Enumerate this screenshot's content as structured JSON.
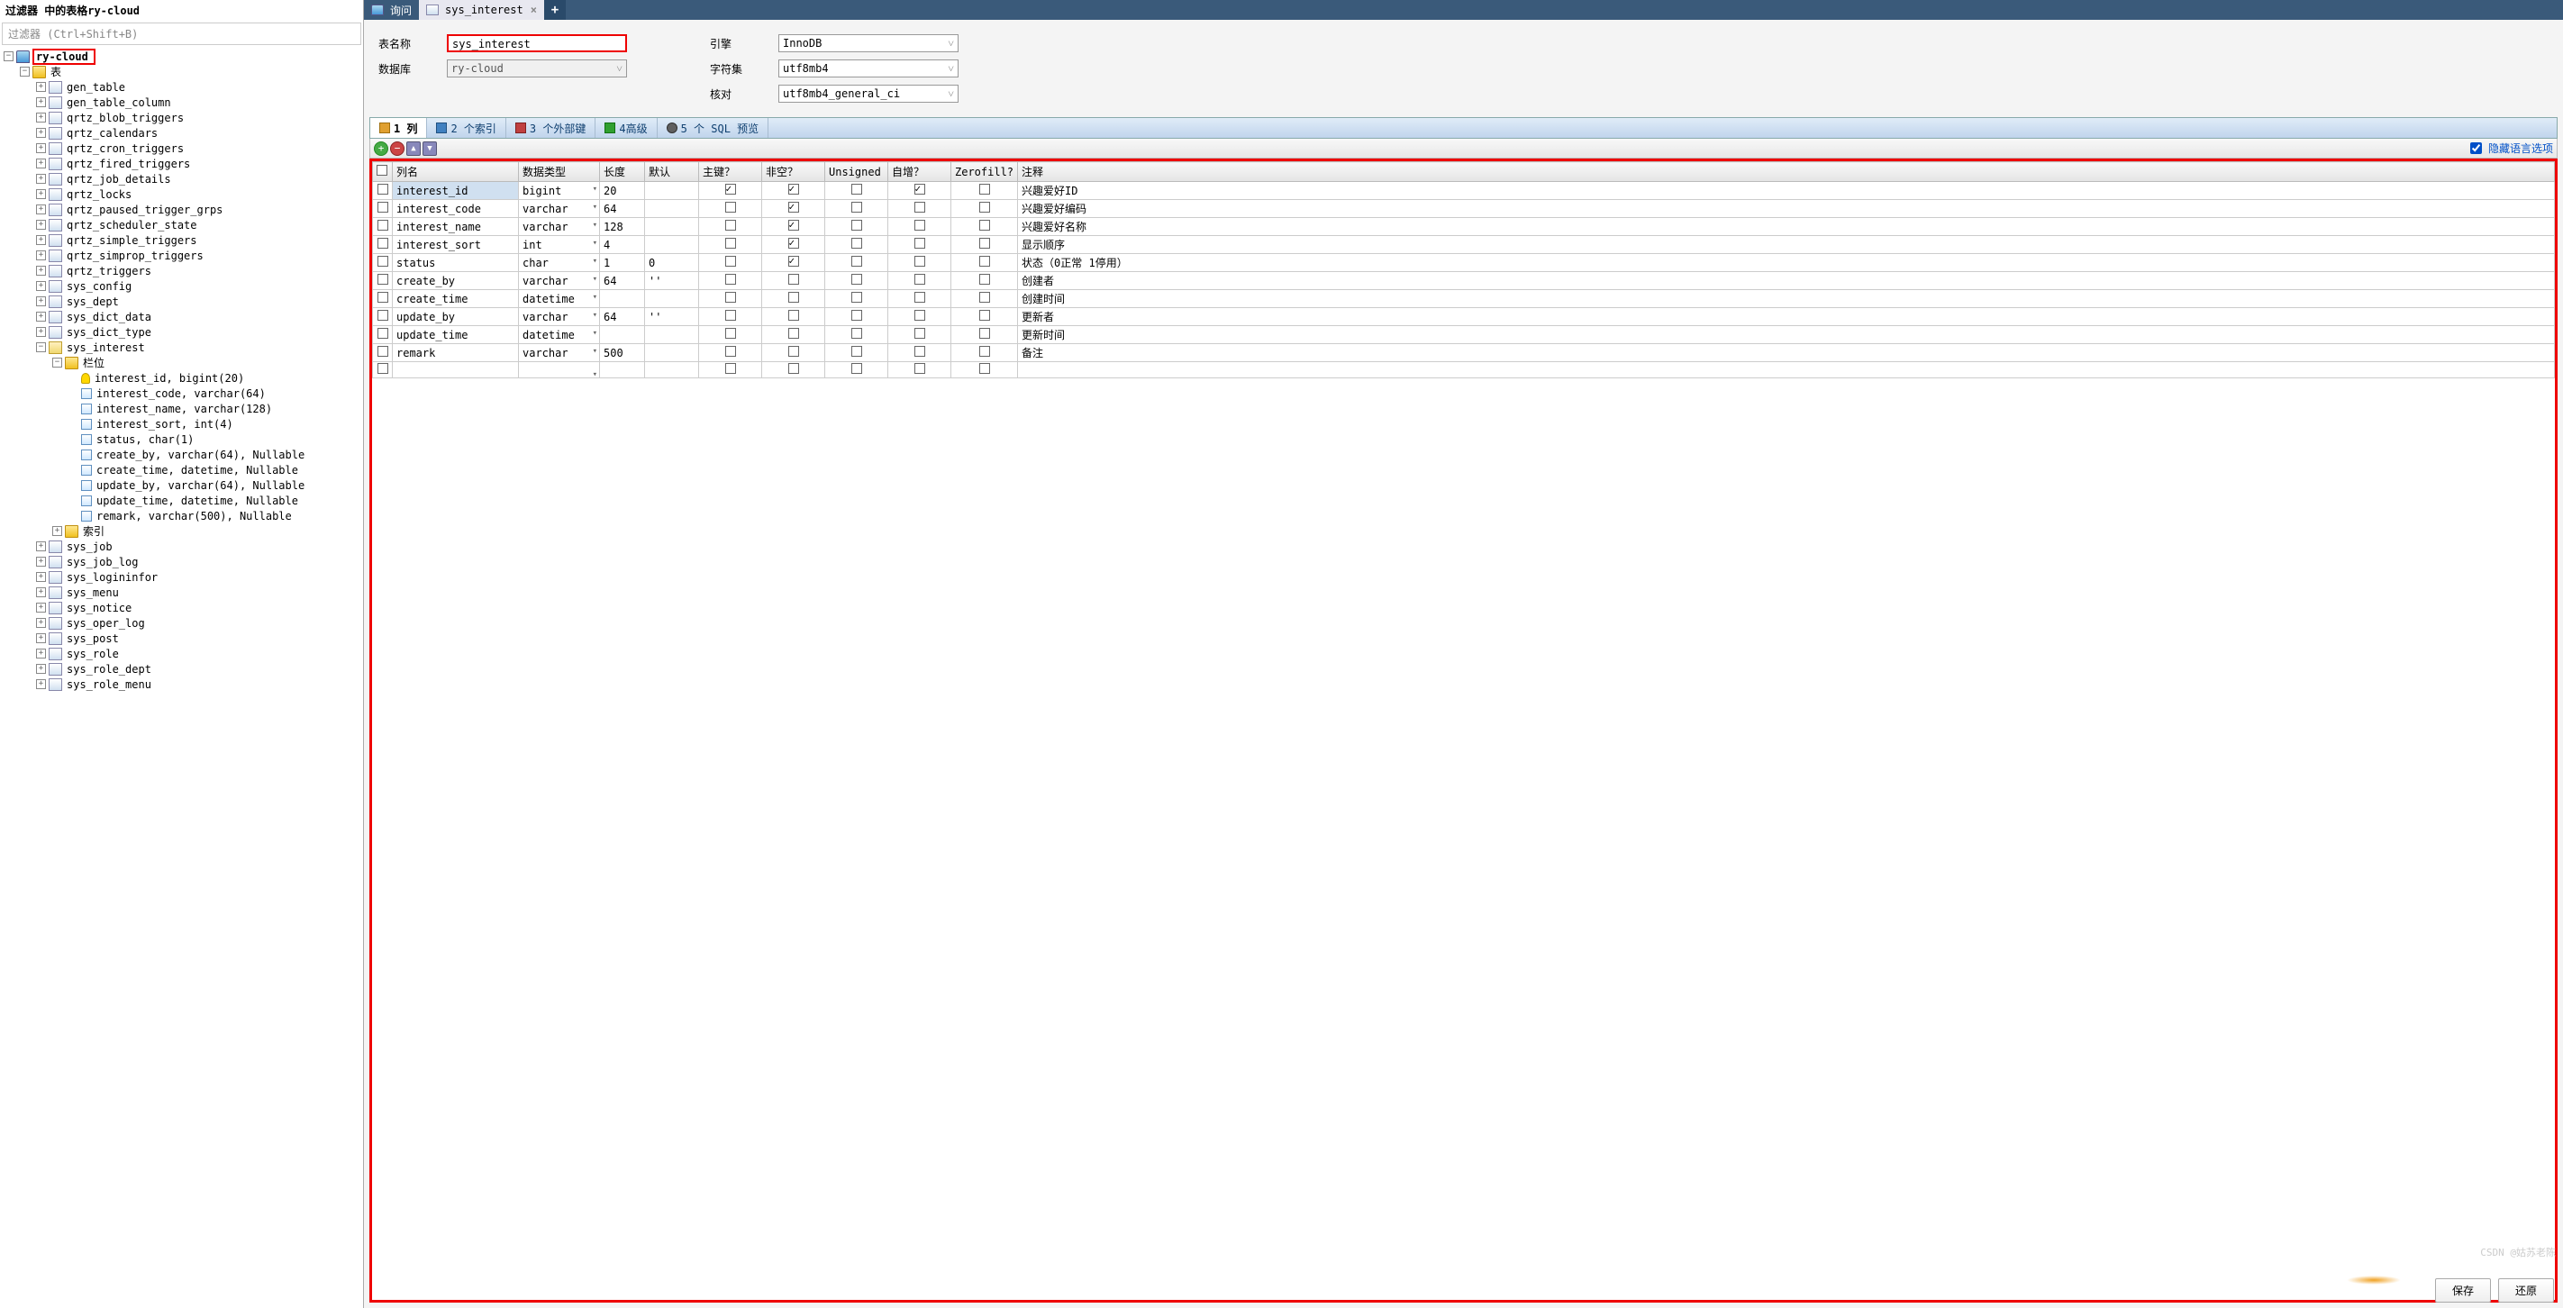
{
  "left": {
    "title": "过滤器 中的表格ry-cloud",
    "filter_placeholder": "过滤器 (Ctrl+Shift+B)",
    "db": "ry-cloud",
    "tables_label": "表",
    "tables": [
      "gen_table",
      "gen_table_column",
      "qrtz_blob_triggers",
      "qrtz_calendars",
      "qrtz_cron_triggers",
      "qrtz_fired_triggers",
      "qrtz_job_details",
      "qrtz_locks",
      "qrtz_paused_trigger_grps",
      "qrtz_scheduler_state",
      "qrtz_simple_triggers",
      "qrtz_simprop_triggers",
      "qrtz_triggers",
      "sys_config",
      "sys_dept",
      "sys_dict_data",
      "sys_dict_type"
    ],
    "selected_table": "sys_interest",
    "columns_label": "栏位",
    "columns": [
      {
        "name": "interest_id, bigint(20)",
        "key": true
      },
      {
        "name": "interest_code, varchar(64)"
      },
      {
        "name": "interest_name, varchar(128)"
      },
      {
        "name": "interest_sort, int(4)"
      },
      {
        "name": "status, char(1)"
      },
      {
        "name": "create_by, varchar(64), Nullable"
      },
      {
        "name": "create_time, datetime, Nullable"
      },
      {
        "name": "update_by, varchar(64), Nullable"
      },
      {
        "name": "update_time, datetime, Nullable"
      },
      {
        "name": "remark, varchar(500), Nullable"
      }
    ],
    "index_label": "索引",
    "tables_after": [
      "sys_job",
      "sys_job_log",
      "sys_logininfor",
      "sys_menu",
      "sys_notice",
      "sys_oper_log",
      "sys_post",
      "sys_role",
      "sys_role_dept",
      "sys_role_menu"
    ]
  },
  "tabs": {
    "query": "询问",
    "active": "sys_interest"
  },
  "form": {
    "name_label": "表名称",
    "name_value": "sys_interest",
    "engine_label": "引擎",
    "engine_value": "InnoDB",
    "db_label": "数据库",
    "db_value": "ry-cloud",
    "charset_label": "字符集",
    "charset_value": "utf8mb4",
    "collate_label": "核对",
    "collate_value": "utf8mb4_general_ci"
  },
  "subtabs": {
    "cols": "1 列",
    "idx": "2 个索引",
    "fk": "3 个外部键",
    "adv": "4高级",
    "sql": "5 个 SQL 预览"
  },
  "toolbar": {
    "hide_lang": "隐藏语言选项"
  },
  "grid": {
    "headers": [
      "列名",
      "数据类型",
      "长度",
      "默认",
      "主键？",
      "非空？",
      "Unsigned",
      "自增？",
      "Zerofill?",
      "注释"
    ],
    "rows": [
      {
        "name": "interest_id",
        "type": "bigint",
        "len": "20",
        "def": "",
        "pk": true,
        "nn": true,
        "us": false,
        "ai": true,
        "zf": false,
        "comment": "兴趣爱好ID",
        "sel": true
      },
      {
        "name": "interest_code",
        "type": "varchar",
        "len": "64",
        "def": "",
        "pk": false,
        "nn": true,
        "us": false,
        "ai": false,
        "zf": false,
        "comment": "兴趣爱好编码"
      },
      {
        "name": "interest_name",
        "type": "varchar",
        "len": "128",
        "def": "",
        "pk": false,
        "nn": true,
        "us": false,
        "ai": false,
        "zf": false,
        "comment": "兴趣爱好名称"
      },
      {
        "name": "interest_sort",
        "type": "int",
        "len": "4",
        "def": "",
        "pk": false,
        "nn": true,
        "us": false,
        "ai": false,
        "zf": false,
        "comment": "显示顺序"
      },
      {
        "name": "status",
        "type": "char",
        "len": "1",
        "def": "0",
        "pk": false,
        "nn": true,
        "us": false,
        "ai": false,
        "zf": false,
        "comment": "状态（0正常 1停用）"
      },
      {
        "name": "create_by",
        "type": "varchar",
        "len": "64",
        "def": "''",
        "pk": false,
        "nn": false,
        "us": false,
        "ai": false,
        "zf": false,
        "comment": "创建者"
      },
      {
        "name": "create_time",
        "type": "datetime",
        "len": "",
        "def": "",
        "pk": false,
        "nn": false,
        "us": false,
        "ai": false,
        "zf": false,
        "comment": "创建时间"
      },
      {
        "name": "update_by",
        "type": "varchar",
        "len": "64",
        "def": "''",
        "pk": false,
        "nn": false,
        "us": false,
        "ai": false,
        "zf": false,
        "comment": "更新者"
      },
      {
        "name": "update_time",
        "type": "datetime",
        "len": "",
        "def": "",
        "pk": false,
        "nn": false,
        "us": false,
        "ai": false,
        "zf": false,
        "comment": "更新时间"
      },
      {
        "name": "remark",
        "type": "varchar",
        "len": "500",
        "def": "",
        "pk": false,
        "nn": false,
        "us": false,
        "ai": false,
        "zf": false,
        "comment": "备注"
      }
    ]
  },
  "buttons": {
    "save": "保存",
    "revert": "还原"
  },
  "watermark": "CSDN @姑苏老陈"
}
